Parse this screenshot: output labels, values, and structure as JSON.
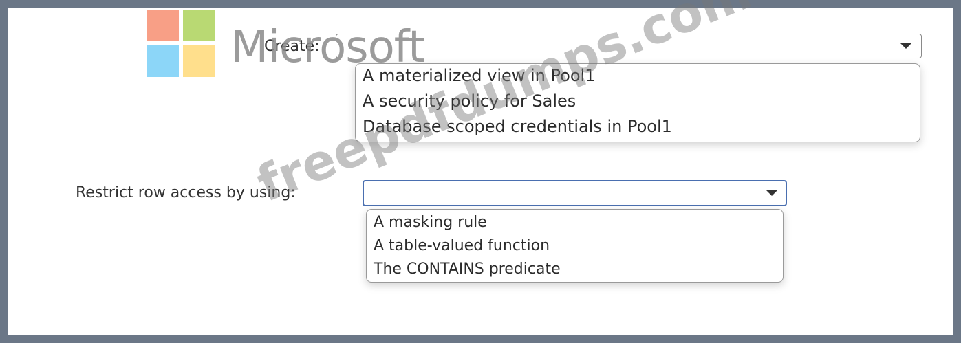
{
  "logo": {
    "text": "Microsoft"
  },
  "watermark": {
    "text": "freepdfdumps.com"
  },
  "create": {
    "label": "Create:",
    "selected": "",
    "options": [
      "A materialized view in Pool1",
      "A security policy for Sales",
      "Database scoped credentials in Pool1"
    ]
  },
  "restrict": {
    "label": "Restrict row access by using:",
    "selected": "",
    "options": [
      "A masking rule",
      "A table-valued function",
      "The CONTAINS predicate"
    ]
  },
  "colors": {
    "frame": "#6b7787",
    "active_border": "#4a6fb0",
    "logo_red": "#f25022",
    "logo_green": "#7fba00",
    "logo_blue": "#00a4ef",
    "logo_yellow": "#ffb900"
  },
  "icons": [
    "chevron-down-icon",
    "microsoft-logo-icon"
  ]
}
